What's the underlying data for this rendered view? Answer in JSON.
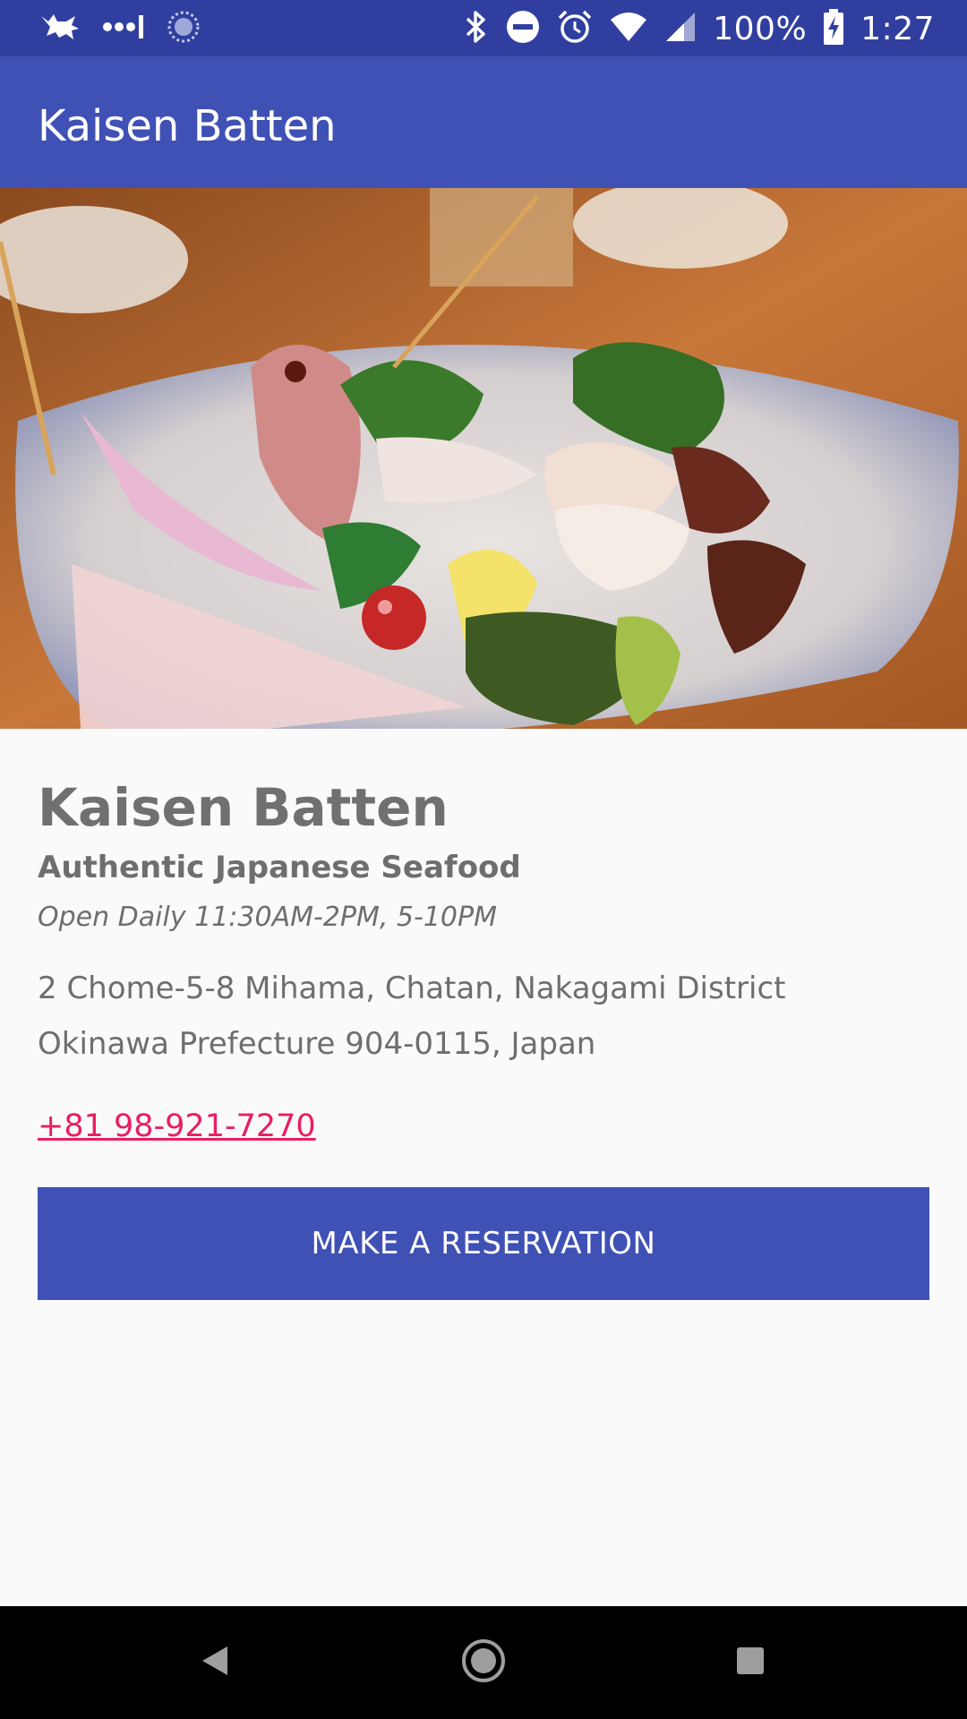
{
  "status_bar": {
    "battery_percent": "100%",
    "time": "1:27",
    "icons": [
      "cat-notification-icon",
      "signal-dots-icon",
      "sync-icon",
      "bluetooth-icon",
      "do-not-disturb-icon",
      "alarm-icon",
      "wifi-icon",
      "cell-signal-icon",
      "battery-charging-icon"
    ]
  },
  "app_bar": {
    "title": "Kaisen Batten"
  },
  "hero_image": {
    "description_icon": "sashimi-platter-photo"
  },
  "restaurant": {
    "name": "Kaisen Batten",
    "tagline": "Authentic Japanese Seafood",
    "hours": "Open Daily 11:30AM-2PM, 5-10PM",
    "address_line1": "2 Chome-5-8 Mihama, Chatan, Nakagami District",
    "address_line2": "Okinawa Prefecture 904-0115, Japan",
    "phone": "+81 98-921-7270"
  },
  "actions": {
    "reserve_label": "MAKE A RESERVATION"
  },
  "nav_bar": {
    "icons": [
      "back-icon",
      "home-icon",
      "recents-icon"
    ]
  },
  "colors": {
    "primary": "#3f51b5",
    "primary_dark": "#303f9f",
    "accent": "#e91e63",
    "text_secondary": "#6e6e6e",
    "background": "#fafafa"
  }
}
